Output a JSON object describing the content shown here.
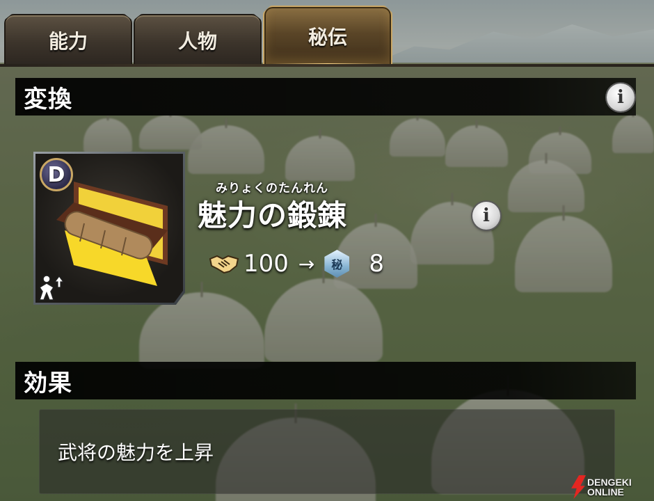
{
  "tabs": [
    {
      "label": "能力",
      "active": false
    },
    {
      "label": "人物",
      "active": false
    },
    {
      "label": "秘伝",
      "active": true
    }
  ],
  "conversion": {
    "header": "変換",
    "item": {
      "rank": "D",
      "furigana": "みりょくのたんれん",
      "name": "魅力の鍛錬",
      "cost_from": "100",
      "arrow": "→",
      "hiden_icon_glyph": "秘",
      "cost_to": "8",
      "icons": {
        "rank": "rank-d-badge",
        "stat": "stat-up-icon",
        "handshake": "handshake-icon",
        "hiden": "hiden-secret-icon"
      }
    }
  },
  "effect": {
    "header": "効果",
    "description": "武将の魅力を上昇"
  },
  "watermark": {
    "brand_line1": "DENGEKI",
    "brand_line2": "ONLINE"
  },
  "colors": {
    "active_tab_border": "#caa867",
    "header_bg": "#000000",
    "hiden_icon": "#88b5d4",
    "watermark_red": "#e42621"
  }
}
